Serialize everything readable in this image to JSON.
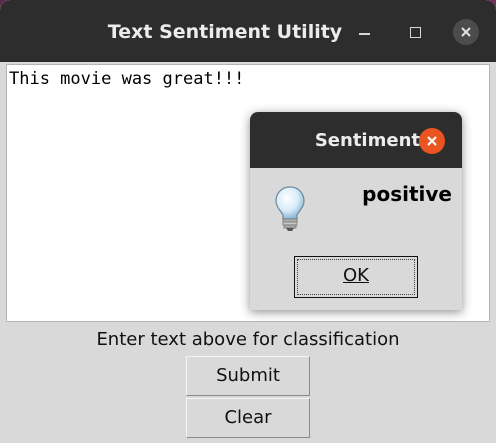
{
  "window": {
    "title": "Text Sentiment Utility"
  },
  "text_area": {
    "value": "This movie was great!!!"
  },
  "status": {
    "label": "Enter text above for classification"
  },
  "buttons": {
    "submit_label": "Submit",
    "clear_label": "Clear"
  },
  "dialog": {
    "title": "Sentiment",
    "message": "positive",
    "ok_label": "OK",
    "icon": "lightbulb-info-icon"
  },
  "colors": {
    "titlebar": "#2d2d2d",
    "dialog_close": "#e95420",
    "window_bg": "#d9d9d9"
  }
}
